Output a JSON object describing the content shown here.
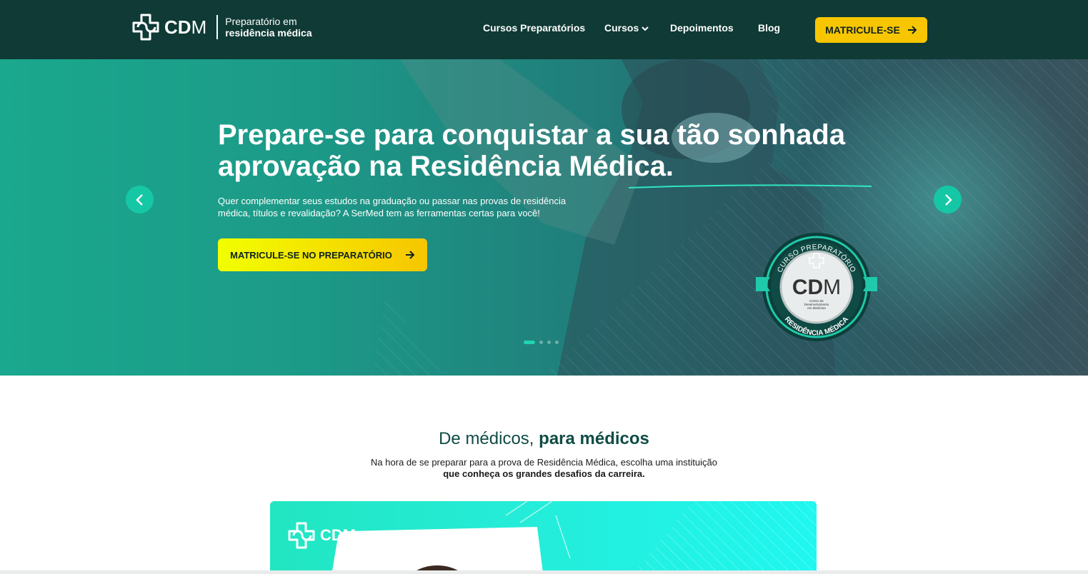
{
  "header": {
    "logo": {
      "brand": "CD",
      "brand_m": "M",
      "tagline_1": "Preparatório em",
      "tagline_2": "residência médica"
    },
    "nav": [
      {
        "label": "Cursos Preparatórios"
      },
      {
        "label": "Cursos",
        "chevron": "chevron-down-icon"
      },
      {
        "label": "Depoimentos"
      },
      {
        "label": "Blog"
      }
    ],
    "cta": "MATRICULE-SE"
  },
  "hero": {
    "title": "Prepare-se para conquistar a sua tão sonhada aprovação na Residência Médica.",
    "subtitle": "Quer complementar seus estudos na graduação ou passar nas provas de residência médica, títulos e revalidação? A SerMed tem as ferramentas certas para você!",
    "cta": "MATRICULE-SE NO PREPARATÓRIO",
    "slides": {
      "count": 4,
      "active": 1
    },
    "seal": {
      "top_text": "CURSO PREPARATÓRIO",
      "brand": "CD",
      "brand_m": "M",
      "small_text_1": "Centro de",
      "small_text_2": "Desenvolvimento",
      "small_text_3": "em Medicina",
      "bottom_text": "RESIDÊNCIA MÉDICA"
    }
  },
  "section": {
    "title_regular": "De médicos,",
    "title_bold": "para médicos",
    "sub_line_1": "Na hora de se preparar para a prova de Residência Médica, escolha uma instituição",
    "sub_line_2": "que conheça os grandes desafios da carreira."
  },
  "promo": {
    "brand": "CDM"
  },
  "colors": {
    "header_bg": "#0f3a35",
    "accent_yellow": "#f7c600",
    "accent_teal": "#16c7a5",
    "section_title": "#0f4c45"
  }
}
